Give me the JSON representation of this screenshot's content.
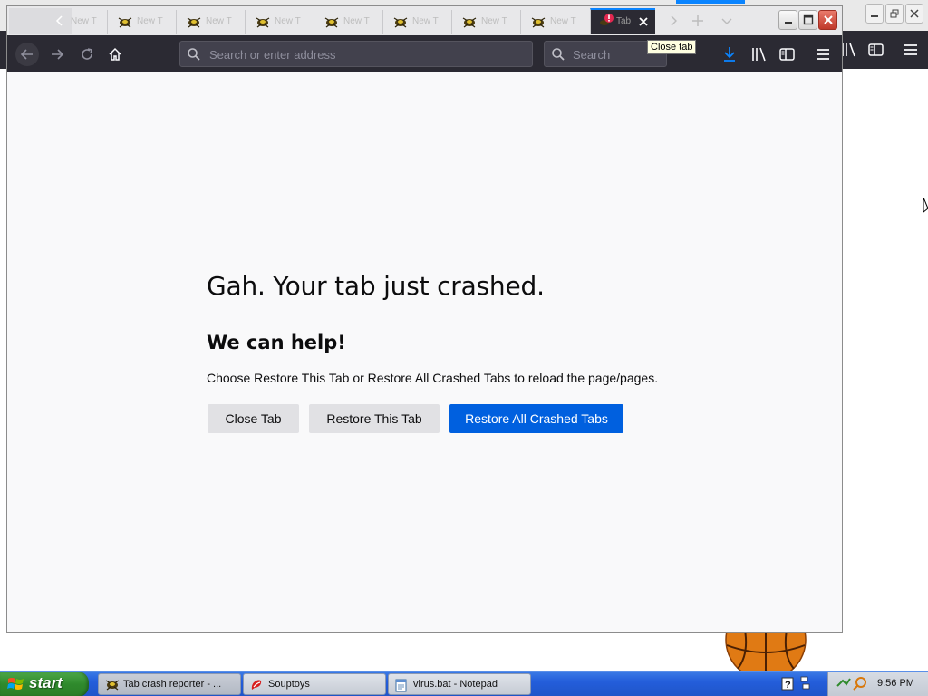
{
  "browser": {
    "tabs": [
      {
        "label": "New T"
      },
      {
        "label": "New T"
      },
      {
        "label": "New T"
      },
      {
        "label": "New T"
      },
      {
        "label": "New T"
      },
      {
        "label": "New T"
      },
      {
        "label": "New T"
      },
      {
        "label": "Tab",
        "active": true
      }
    ],
    "url_placeholder": "Search or enter address",
    "search_placeholder": "Search",
    "tooltip": "Close tab"
  },
  "crash": {
    "title": "Gah. Your tab just crashed.",
    "subtitle": "We can help!",
    "description": "Choose Restore This Tab or Restore All Crashed Tabs to reload the page/pages.",
    "buttons": {
      "close_tab": "Close Tab",
      "restore_tab": "Restore This Tab",
      "restore_all": "Restore All Crashed Tabs"
    }
  },
  "taskbar": {
    "start_label": "start",
    "tasks": [
      {
        "label": "Tab crash reporter - ...",
        "icon": "firefox-bug-icon",
        "active": true
      },
      {
        "label": "Souptoys",
        "icon": "souptoys-icon"
      },
      {
        "label": "virus.bat - Notepad",
        "icon": "notepad-icon"
      }
    ],
    "clock": "9:56 PM"
  },
  "colors": {
    "accent": "#0a84ff",
    "primary_button": "#0060df",
    "toolbar": "#2b2a33",
    "taskbar": "#245edb",
    "start": "#2f8a2c"
  }
}
